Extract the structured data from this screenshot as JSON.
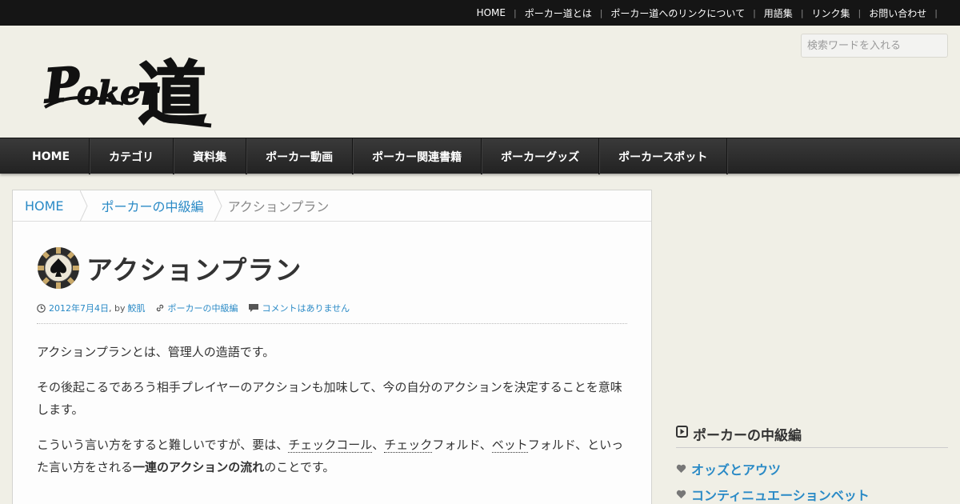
{
  "topnav": {
    "items": [
      "HOME",
      "ポーカー道とは",
      "ポーカー道へのリンクについて",
      "用語集",
      "リンク集",
      "お問い合わせ"
    ]
  },
  "header": {
    "logo_text": "Poker道",
    "search_placeholder": "検索ワードを入れる"
  },
  "mainnav": {
    "items": [
      "HOME",
      "カテゴリ",
      "資料集",
      "ポーカー動画",
      "ポーカー関連書籍",
      "ポーカーグッズ",
      "ポーカースポット"
    ]
  },
  "breadcrumb": {
    "home": "HOME",
    "category": "ポーカーの中級編",
    "current": "アクションプラン"
  },
  "post": {
    "title": "アクションプラン",
    "date": "2012年7月4日",
    "by": ", by",
    "author": "鮫肌",
    "category": "ポーカーの中級編",
    "comments": "コメントはありません",
    "p1": "アクションプランとは、管理人の造語です。",
    "p2": "その後起こるであろう相手プレイヤーのアクションも加味して、今の自分のアクションを決定することを意味します。",
    "p3_a": "こういう言い方をすると難しいですが、要は、",
    "p3_link1": "チェックコール",
    "p3_b": "、",
    "p3_link2": "チェック",
    "p3_c": "フォルド、",
    "p3_link3": "ベット",
    "p3_d": "フォルド、といった言い方をされる",
    "p3_strong": "一連のアクションの流れ",
    "p3_e": "のことです。"
  },
  "sidebar": {
    "widget_title": "ポーカーの中級編",
    "items": [
      "オッズとアウツ",
      "コンティニュエーションベット"
    ]
  },
  "colors": {
    "accent": "#2a8ac6",
    "topbar": "#151515",
    "background": "#f0efe6"
  }
}
